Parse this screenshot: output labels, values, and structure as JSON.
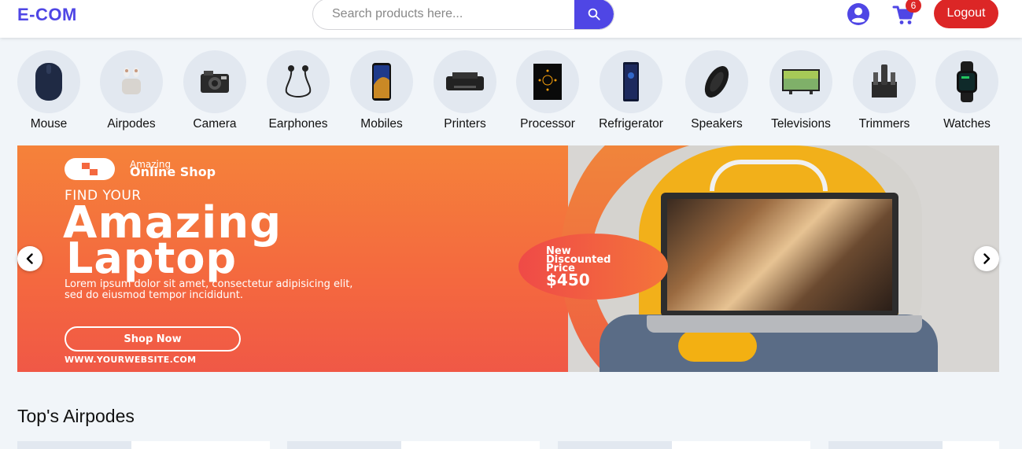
{
  "header": {
    "logo": "E-COM",
    "search_placeholder": "Search products here...",
    "cart_count": "6",
    "logout_label": "Logout",
    "accent_color": "#4f46e5",
    "danger_color": "#dc2626"
  },
  "categories": [
    {
      "label": "Mouse",
      "icon": "mouse-icon"
    },
    {
      "label": "Airpodes",
      "icon": "airpods-icon"
    },
    {
      "label": "Camera",
      "icon": "camera-icon"
    },
    {
      "label": "Earphones",
      "icon": "earphones-icon"
    },
    {
      "label": "Mobiles",
      "icon": "mobile-icon"
    },
    {
      "label": "Printers",
      "icon": "printer-icon"
    },
    {
      "label": "Processor",
      "icon": "processor-icon"
    },
    {
      "label": "Refrigerator",
      "icon": "refrigerator-icon"
    },
    {
      "label": "Speakers",
      "icon": "speaker-icon"
    },
    {
      "label": "Televisions",
      "icon": "television-icon"
    },
    {
      "label": "Trimmers",
      "icon": "trimmer-icon"
    },
    {
      "label": "Watches",
      "icon": "watch-icon"
    }
  ],
  "banner": {
    "brand_small": "Amazing",
    "brand": "Online Shop",
    "find": "FIND YOUR",
    "title_line1": "Amazing",
    "title_line2": "Laptop",
    "lorem": "Lorem ipsum dolor sit amet, consectetur adipisicing elit, sed do eiusmod tempor incididunt.",
    "shop_now": "Shop Now",
    "url": "WWW.YOURWEBSITE.COM",
    "discount_line1": "New",
    "discount_line2": "Discounted",
    "discount_line3": "Price",
    "price": "$450"
  },
  "section": {
    "title": "Top's Airpodes"
  }
}
